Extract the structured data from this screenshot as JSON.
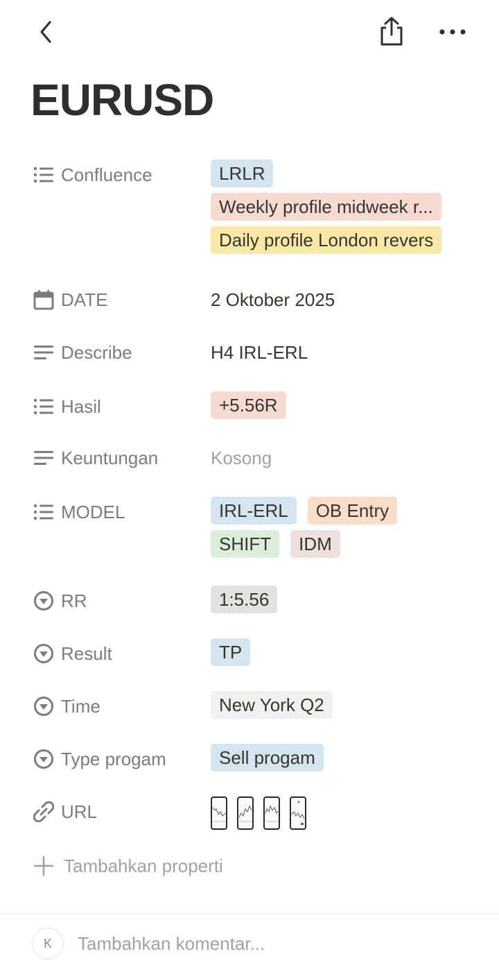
{
  "header": {
    "back_icon": "chevron-left-icon",
    "share_icon": "share-icon",
    "more_icon": "more-horizontal-icon"
  },
  "page": {
    "title": "EURUSD"
  },
  "properties": {
    "confluence": {
      "label": "Confluence",
      "icon": "multi-select-icon",
      "tags": [
        {
          "text": "LRLR",
          "color": "#d3e5ef"
        },
        {
          "text": "Weekly profile midweek r...",
          "color": "#f6dcd0"
        },
        {
          "text": "Daily profile London revers",
          "color": "#f9e9a8"
        }
      ]
    },
    "date": {
      "label": "DATE",
      "icon": "calendar-icon",
      "value": "2 Oktober 2025"
    },
    "describe": {
      "label": "Describe",
      "icon": "text-icon",
      "value": "H4 IRL-ERL"
    },
    "hasil": {
      "label": "Hasil",
      "icon": "multi-select-icon",
      "tags": [
        {
          "text": "+5.56R",
          "color": "#f6dcd0"
        }
      ]
    },
    "keuntungan": {
      "label": "Keuntungan",
      "icon": "text-icon",
      "placeholder": "Kosong"
    },
    "model": {
      "label": "MODEL",
      "icon": "multi-select-icon",
      "tags": [
        {
          "text": "IRL-ERL",
          "color": "#d3e5ef"
        },
        {
          "text": "OB Entry",
          "color": "#fadec9"
        },
        {
          "text": "SHIFT",
          "color": "#dbeddb"
        },
        {
          "text": "IDM",
          "color": "#eee0da"
        }
      ]
    },
    "rr": {
      "label": "RR",
      "icon": "select-icon",
      "tag": {
        "text": "1:5.56",
        "color": "#e3e2e0"
      }
    },
    "result": {
      "label": "Result",
      "icon": "select-icon",
      "tag": {
        "text": "TP",
        "color": "#d3e5ef"
      }
    },
    "time": {
      "label": "Time",
      "icon": "select-icon",
      "tag": {
        "text": "New York Q2",
        "color": "#f1f1ef"
      }
    },
    "type_progam": {
      "label": "Type progam",
      "icon": "select-icon",
      "tag": {
        "text": "Sell progam",
        "color": "#d3e5ef"
      }
    },
    "url": {
      "label": "URL",
      "icon": "link-icon",
      "thumbnail_count": 4
    }
  },
  "add_property": {
    "label": "Tambahkan properti",
    "icon": "plus-icon"
  },
  "comment": {
    "avatar_initial": "K",
    "placeholder": "Tambahkan komentar..."
  }
}
